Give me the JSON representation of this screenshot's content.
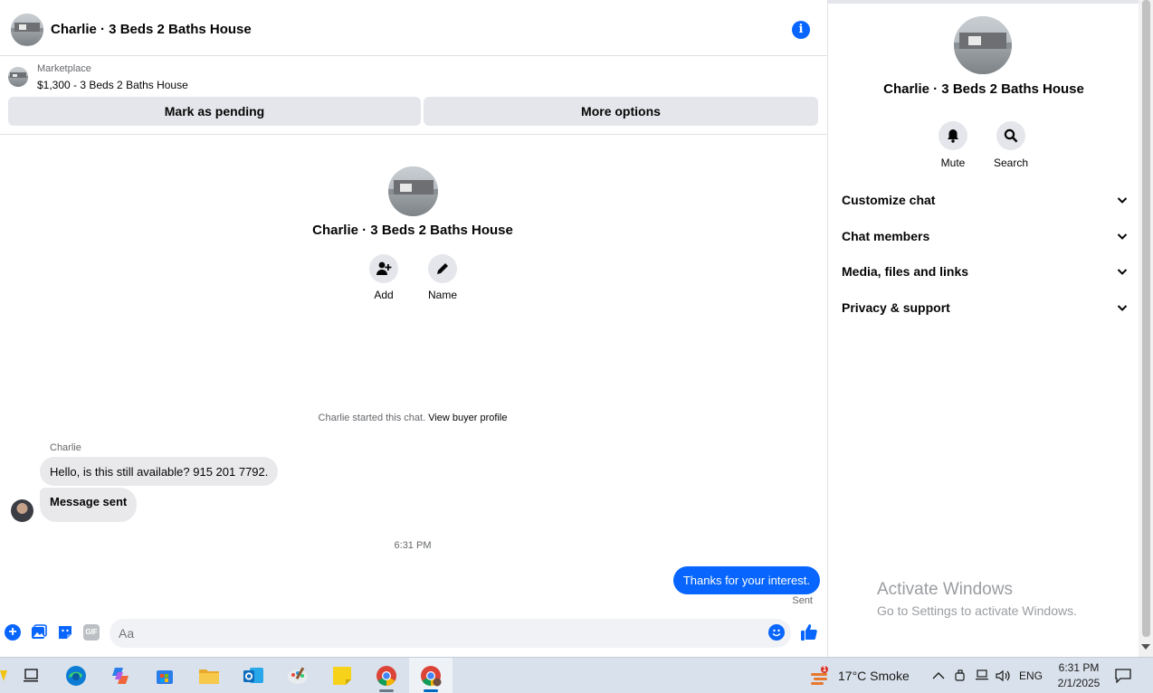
{
  "chat": {
    "title": "Charlie · 3 Beds 2 Baths House",
    "listing": {
      "source": "Marketplace",
      "price_title": "$1,300 - 3 Beds 2 Baths House",
      "mark_pending_label": "Mark as pending",
      "more_options_label": "More options"
    },
    "intro": {
      "title": "Charlie · 3 Beds 2 Baths House",
      "add_label": "Add",
      "name_label": "Name"
    },
    "started_text": "Charlie started this chat.",
    "view_profile_label": "View buyer profile",
    "messages": [
      {
        "sender": "Charlie",
        "text": "Hello, is this still available? 915 201 7792."
      },
      {
        "sender": "Charlie",
        "text": "Message sent"
      }
    ],
    "timestamp": "6:31 PM",
    "outgoing": {
      "text": "Thanks for your interest.",
      "status": "Sent"
    },
    "composer": {
      "placeholder": "Aa",
      "gif_label": "GIF"
    }
  },
  "info": {
    "title": "Charlie · 3 Beds 2 Baths House",
    "actions": [
      {
        "label": "Mute",
        "icon": "bell-icon"
      },
      {
        "label": "Search",
        "icon": "search-icon"
      }
    ],
    "sections": [
      {
        "label": "Customize chat"
      },
      {
        "label": "Chat members"
      },
      {
        "label": "Media, files and links"
      },
      {
        "label": "Privacy & support"
      }
    ]
  },
  "watermark": {
    "title": "Activate Windows",
    "subtitle": "Go to Settings to activate Windows."
  },
  "taskbar": {
    "weather": "17°C  Smoke",
    "notification_count": "1",
    "language": "ENG",
    "time": "6:31 PM",
    "date": "2/1/2025"
  },
  "colors": {
    "accent": "#0866ff",
    "bubble_in": "#e9e9eb",
    "button_bg": "#e4e6eb"
  }
}
